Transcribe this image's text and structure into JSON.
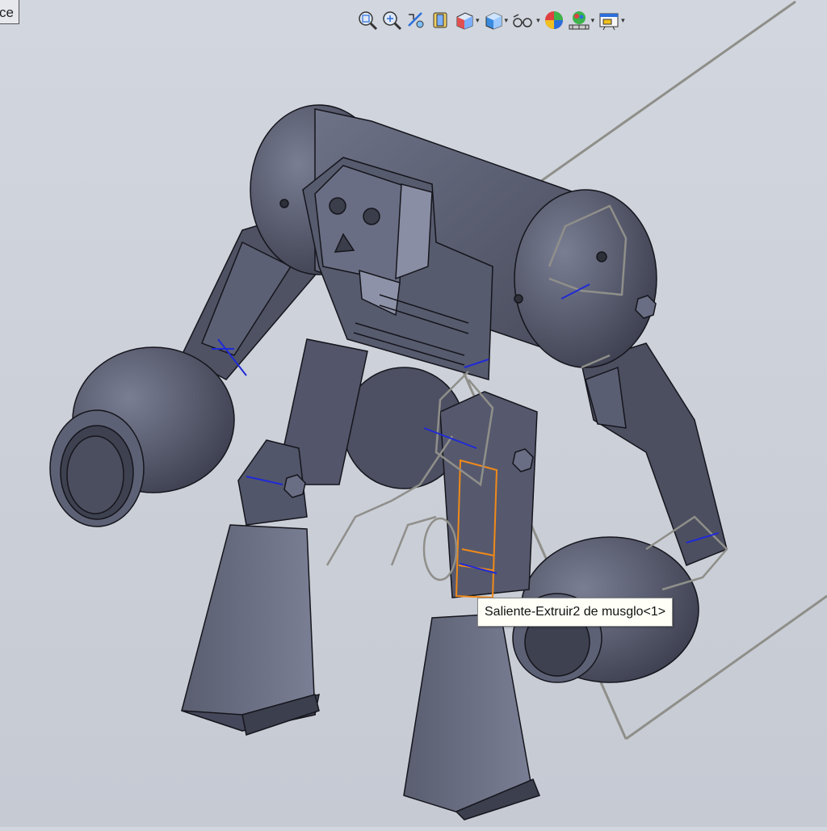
{
  "window": {
    "corner_tab_text": "ce"
  },
  "toolbar": {
    "items": [
      {
        "icon": "zoom-to-fit-icon",
        "has_dropdown": false
      },
      {
        "icon": "zoom-to-area-icon",
        "has_dropdown": false
      },
      {
        "icon": "previous-view-icon",
        "has_dropdown": false
      },
      {
        "icon": "section-view-icon",
        "has_dropdown": false
      },
      {
        "icon": "view-orientation-icon",
        "has_dropdown": true
      },
      {
        "icon": "display-style-icon",
        "has_dropdown": true
      },
      {
        "icon": "hide-show-items-icon",
        "has_dropdown": true
      },
      {
        "icon": "edit-appearance-icon",
        "has_dropdown": false
      },
      {
        "icon": "apply-scene-icon",
        "has_dropdown": true
      },
      {
        "icon": "view-settings-icon",
        "has_dropdown": true
      }
    ],
    "dropdown_glyph": "▾"
  },
  "tooltip": {
    "text": "Saliente-Extruir2 de musglo<1>"
  },
  "colors": {
    "model_dark": "#4f5263",
    "model_mid": "#60647a",
    "model_light": "#8a8ea4",
    "edge": "#15151c",
    "sketch_gray": "#8f8f8a",
    "dimension_blue": "#1f2ad6",
    "selection_orange": "#f08a1a",
    "background": "#cdd1d9"
  }
}
